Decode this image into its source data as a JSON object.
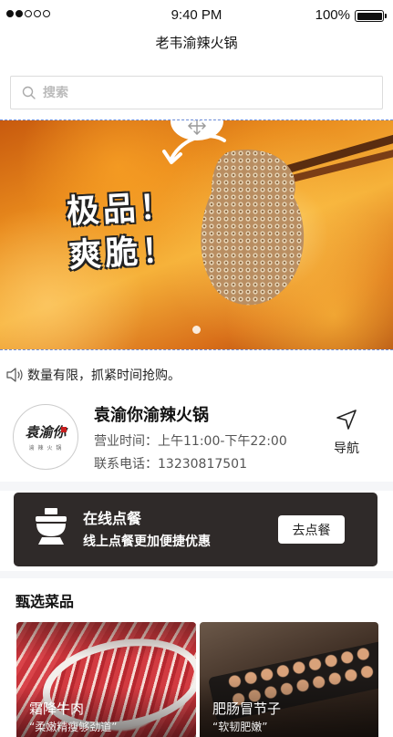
{
  "status_bar": {
    "time": "9:40 PM",
    "battery": "100%",
    "signal_bars": 5,
    "signal_filled": 2
  },
  "nav": {
    "title": "老韦渝辣火锅"
  },
  "search": {
    "placeholder": "搜索"
  },
  "banner": {
    "text": "极品！\n爽脆！",
    "active_slide": 1,
    "slide_count": 1
  },
  "notice": {
    "text": "数量有限，抓紧时间抢购。"
  },
  "store": {
    "logo_text": "袁渝你",
    "logo_sub": "渝 辣 火 锅",
    "name": "袁渝你渝辣火锅",
    "hours": "营业时间：上午11:00-下午22:00",
    "phone": "联系电话：13230817501",
    "navigate_label": "导航"
  },
  "online_order": {
    "title": "在线点餐",
    "subtitle": "线上点餐更加便捷优惠",
    "button_label": "去点餐"
  },
  "featured": {
    "title": "甄选菜品",
    "dishes": [
      {
        "name": "霜降牛肉",
        "desc": "“柔嫩精瘦够劲道”"
      },
      {
        "name": "肥肠冒节子",
        "desc": "“软韧肥嫩”"
      }
    ]
  }
}
